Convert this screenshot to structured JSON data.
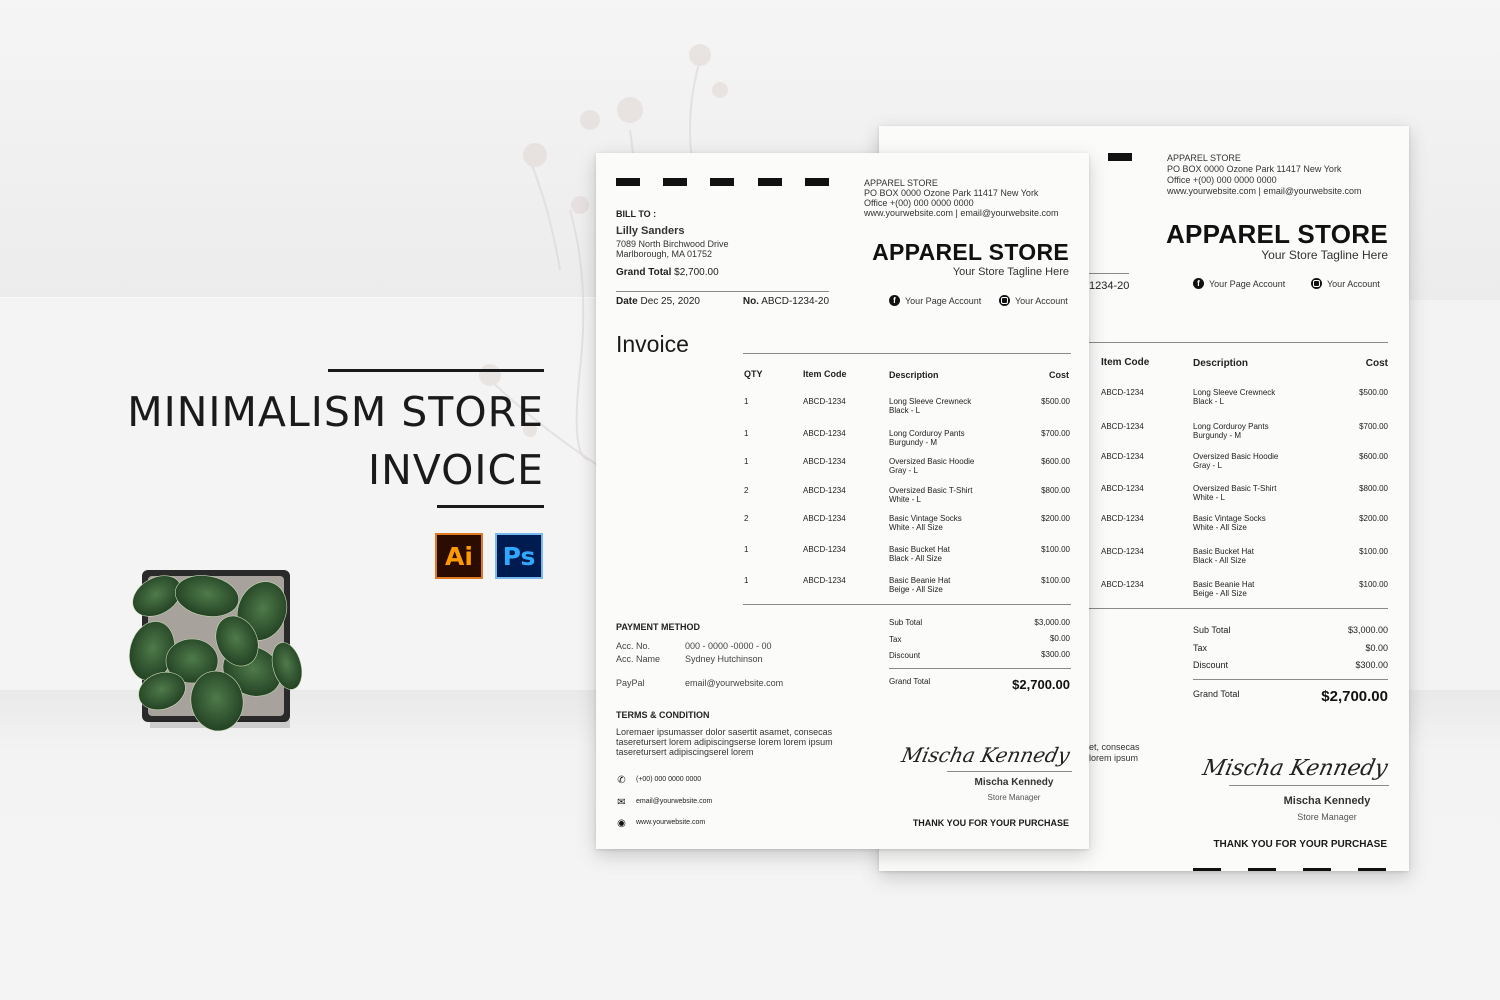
{
  "promo": {
    "title_line1": "MINIMALISM STORE",
    "title_line2": "INVOICE",
    "app_badges": [
      {
        "label": "Ai",
        "name": "adobe-illustrator-icon",
        "bg": "#2b0c00",
        "fg": "#ff9a00"
      },
      {
        "label": "Ps",
        "name": "adobe-photoshop-icon",
        "bg": "#001b4f",
        "fg": "#31a8ff"
      }
    ]
  },
  "store": {
    "name_small": "APPAREL STORE",
    "address": "PO BOX 0000 Ozone Park 11417 New York",
    "office": "Office +(00) 000 0000 0000",
    "web_email": "www.yourwebsite.com | email@yourwebsite.com",
    "name_large": "APPAREL STORE",
    "tagline": "Your Store Tagline Here",
    "social_facebook": "Your Page Account",
    "social_instagram": "Your Account"
  },
  "bill_to": {
    "label": "BILL TO :",
    "name": "Lilly Sanders",
    "address1": "7089 North Birchwood Drive",
    "address2": "Marlborough, MA 01752",
    "grand_total_label": "Grand Total",
    "grand_total_value": "$2,700.00"
  },
  "meta": {
    "date_label": "Date",
    "date_value": "Dec 25, 2020",
    "no_label": "No.",
    "no_value": "ABCD-1234-20",
    "no_value_partial": "1234-20"
  },
  "invoice_heading": "Invoice",
  "table": {
    "headers": {
      "qty": "QTY",
      "code": "Item Code",
      "desc": "Description",
      "cost": "Cost"
    },
    "rows": [
      {
        "qty": "1",
        "code": "ABCD-1234",
        "desc1": "Long Sleeve Crewneck",
        "desc2": "Black - L",
        "cost": "$500.00"
      },
      {
        "qty": "1",
        "code": "ABCD-1234",
        "desc1": "Long Corduroy Pants",
        "desc2": "Burgundy - M",
        "cost": "$700.00"
      },
      {
        "qty": "1",
        "code": "ABCD-1234",
        "desc1": "Oversized Basic Hoodie",
        "desc2": "Gray - L",
        "cost": "$600.00"
      },
      {
        "qty": "2",
        "code": "ABCD-1234",
        "desc1": "Oversized Basic T-Shirt",
        "desc2": "White - L",
        "cost": "$800.00"
      },
      {
        "qty": "2",
        "code": "ABCD-1234",
        "desc1": "Basic Vintage Socks",
        "desc2": "White - All Size",
        "cost": "$200.00"
      },
      {
        "qty": "1",
        "code": "ABCD-1234",
        "desc1": "Basic Bucket Hat",
        "desc2": "Black - All Size",
        "cost": "$100.00"
      },
      {
        "qty": "1",
        "code": "ABCD-1234",
        "desc1": "Basic Beanie Hat",
        "desc2": "Beige - All Size",
        "cost": "$100.00"
      }
    ]
  },
  "totals": {
    "subtotal_label": "Sub Total",
    "subtotal_value": "$3,000.00",
    "tax_label": "Tax",
    "tax_value": "$0.00",
    "discount_label": "Discount",
    "discount_value": "$300.00",
    "grand_label": "Grand Total",
    "grand_value": "$2,700.00"
  },
  "payment": {
    "heading": "PAYMENT METHOD",
    "acc_no_label": "Acc. No.",
    "acc_no_value": "000 - 0000 -0000 - 00",
    "acc_name_label": "Acc. Name",
    "acc_name_value": "Sydney Hutchinson",
    "paypal_label": "PayPal",
    "paypal_value": "email@yourwebsite.com"
  },
  "terms": {
    "heading": "TERMS & CONDITION",
    "line1": "Loremaer ipsumasser dolor sasertit asamet, consecas",
    "line2": "taseretursert lorem adipiscingserse lorem lorem ipsum",
    "line3": "taseretursert adipiscingserel lorem",
    "line1_partial": "et, consecas",
    "line2_partial": "lorem ipsum"
  },
  "contact": {
    "phone": "(+00) 000 0000 0000",
    "email": "email@yourwebsite.com",
    "web": "www.yourwebsite.com"
  },
  "signature": {
    "script": "Mischa Kennedy",
    "name": "Mischa Kennedy",
    "role": "Store Manager"
  },
  "thank_you": "THANK YOU FOR YOUR PURCHASE"
}
